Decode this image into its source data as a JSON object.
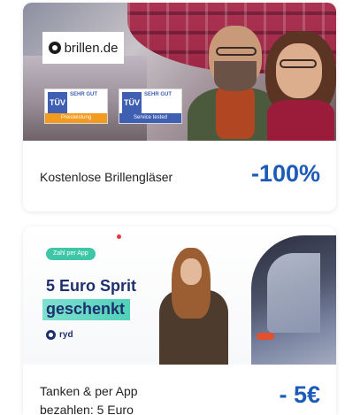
{
  "offers": [
    {
      "brand_logo": "brillen.de",
      "badges": [
        {
          "mark": "TÜV",
          "grade": "SEHR GUT",
          "strip": "Preisleistung"
        },
        {
          "mark": "TÜV",
          "grade": "SEHR GUT",
          "strip": "Service tested"
        }
      ],
      "title": "Kostenlose Brillengläser",
      "discount": "-100%",
      "colors": {
        "discount": "#1d5bb8"
      }
    },
    {
      "pill": "Zahl per App",
      "promo_line1": "5 Euro Sprit",
      "promo_line2": "geschenkt",
      "brand": "ryd",
      "title_line1": "Tanken & per App",
      "title_line2": "bezahlen: 5 Euro",
      "discount": "- 5€",
      "colors": {
        "discount": "#1d5bb8",
        "accent": "#3ec6a6"
      }
    }
  ]
}
